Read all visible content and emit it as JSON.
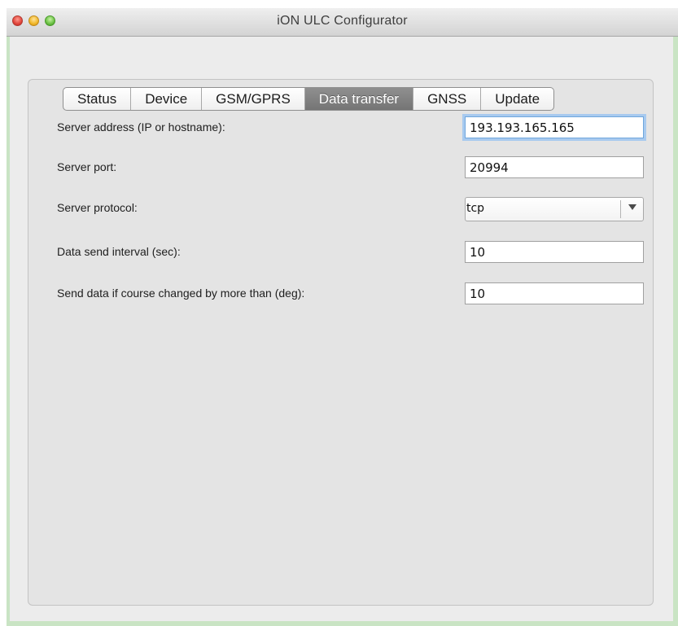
{
  "window": {
    "title": "iON ULC Configurator"
  },
  "tabs": [
    {
      "label": "Status",
      "active": false
    },
    {
      "label": "Device",
      "active": false
    },
    {
      "label": "GSM/GPRS",
      "active": false
    },
    {
      "label": "Data transfer",
      "active": true
    },
    {
      "label": "GNSS",
      "active": false
    },
    {
      "label": "Update",
      "active": false
    }
  ],
  "form": {
    "server_address": {
      "label": "Server address (IP or hostname):",
      "value": "193.193.165.165"
    },
    "server_port": {
      "label": "Server port:",
      "value": "20994"
    },
    "server_protocol": {
      "label": "Server protocol:",
      "value": "tcp",
      "icon": "chevron-down-icon"
    },
    "data_send_interval": {
      "label": "Data send interval (sec):",
      "value": "10"
    },
    "course_change": {
      "label": "Send data if course changed by more than (deg):",
      "value": "10"
    }
  },
  "colors": {
    "window_frame_accent": "#c9e4c4",
    "active_tab": "#828282",
    "focus_ring": "#a8caef"
  }
}
